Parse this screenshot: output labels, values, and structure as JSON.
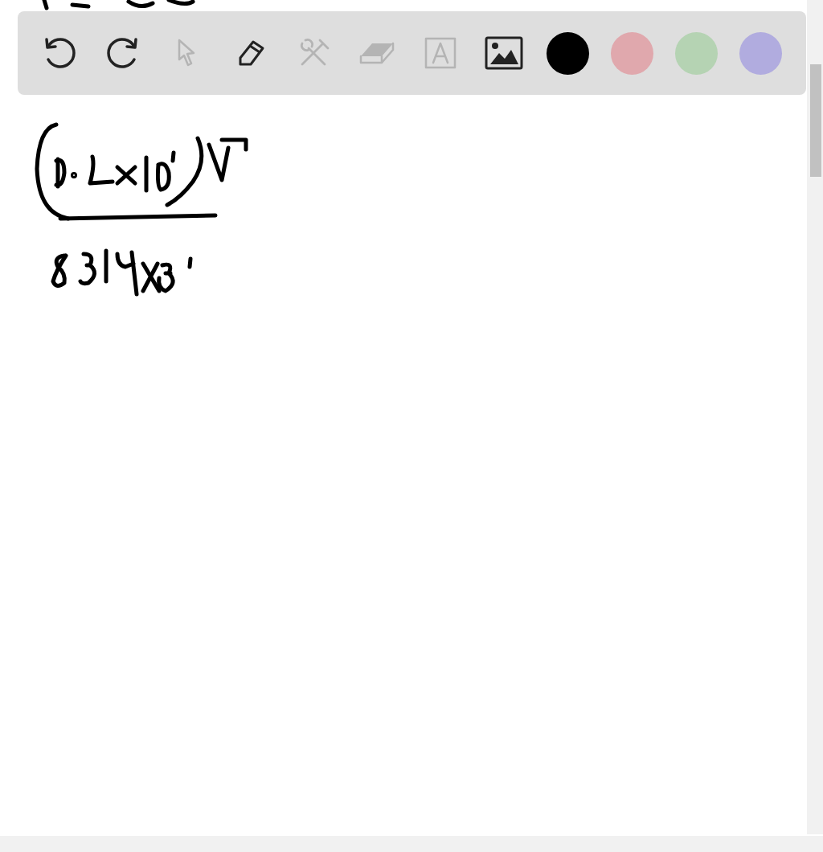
{
  "toolbar": {
    "tools": [
      {
        "kind": "undo",
        "disabled": false
      },
      {
        "kind": "redo",
        "disabled": false
      },
      {
        "kind": "select",
        "disabled": true
      },
      {
        "kind": "pen",
        "disabled": false
      },
      {
        "kind": "tools",
        "disabled": true
      },
      {
        "kind": "eraser",
        "disabled": true
      },
      {
        "kind": "text",
        "disabled": true
      },
      {
        "kind": "image",
        "disabled": false
      }
    ],
    "colors": [
      {
        "color": "#000000"
      },
      {
        "color": "#e0a8ad"
      },
      {
        "color": "#b5d3b3"
      },
      {
        "color": "#b1acdf"
      }
    ]
  }
}
